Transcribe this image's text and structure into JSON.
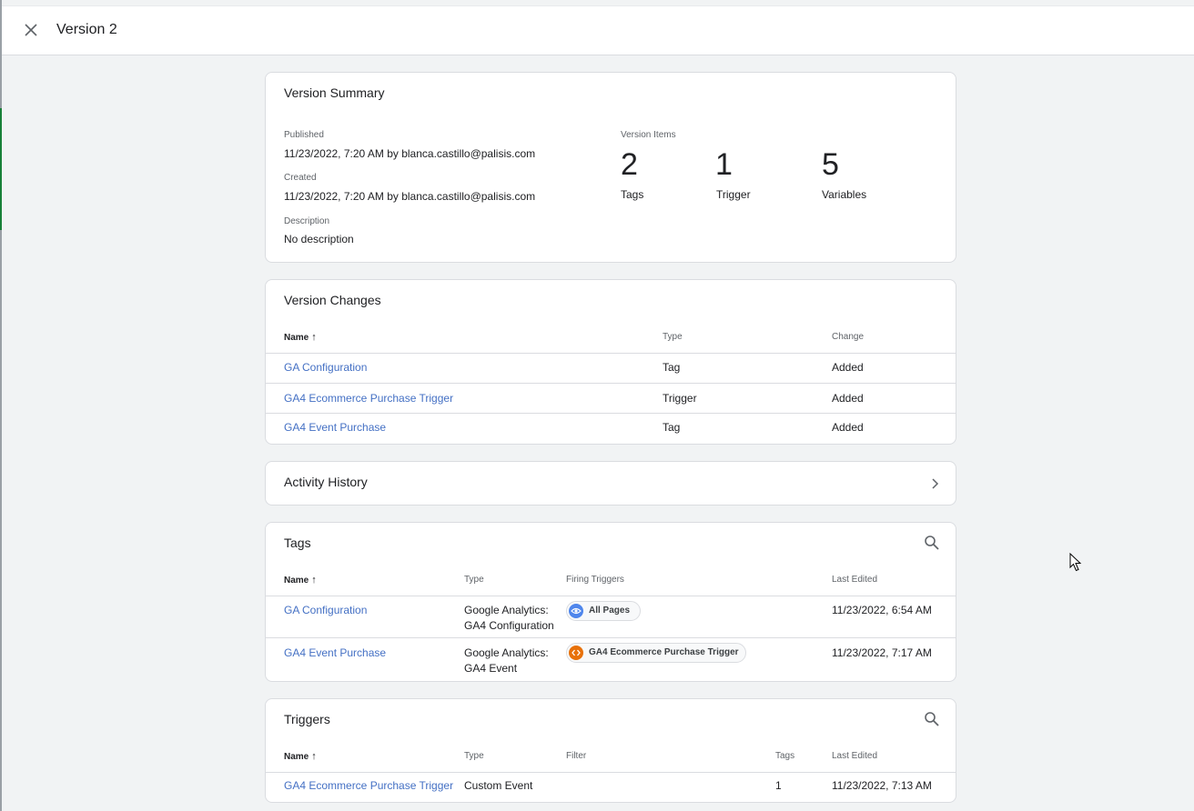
{
  "header": {
    "title": "Version 2"
  },
  "summary": {
    "title": "Version Summary",
    "published_label": "Published",
    "published_value": "11/23/2022, 7:20 AM by blanca.castillo@palisis.com",
    "created_label": "Created",
    "created_value": "11/23/2022, 7:20 AM by blanca.castillo@palisis.com",
    "description_label": "Description",
    "description_value": "No description",
    "items_label": "Version Items",
    "items": [
      {
        "count": "2",
        "label": "Tags"
      },
      {
        "count": "1",
        "label": "Trigger"
      },
      {
        "count": "5",
        "label": "Variables"
      }
    ]
  },
  "changes": {
    "title": "Version Changes",
    "columns": {
      "name": "Name",
      "type": "Type",
      "change": "Change"
    },
    "rows": [
      {
        "name": "GA Configuration",
        "type": "Tag",
        "change": "Added"
      },
      {
        "name": "GA4 Ecommerce Purchase Trigger",
        "type": "Trigger",
        "change": "Added"
      },
      {
        "name": "GA4 Event Purchase",
        "type": "Tag",
        "change": "Added"
      }
    ]
  },
  "activity": {
    "title": "Activity History"
  },
  "tags": {
    "title": "Tags",
    "columns": {
      "name": "Name",
      "type": "Type",
      "firing": "Firing Triggers",
      "edited": "Last Edited"
    },
    "rows": [
      {
        "name": "GA Configuration",
        "type": "Google Analytics: GA4 Configuration",
        "trigger": "All Pages",
        "trigger_icon": "eye-icon",
        "trigger_color": "#4f86ec",
        "edited": "11/23/2022, 6:54 AM"
      },
      {
        "name": "GA4 Event Purchase",
        "type": "Google Analytics: GA4 Event",
        "trigger": "GA4 Ecommerce Purchase Trigger",
        "trigger_icon": "code-icon",
        "trigger_color": "#e8710a",
        "edited": "11/23/2022, 7:17 AM"
      }
    ]
  },
  "triggers": {
    "title": "Triggers",
    "columns": {
      "name": "Name",
      "type": "Type",
      "filter": "Filter",
      "tags": "Tags",
      "edited": "Last Edited"
    },
    "rows": [
      {
        "name": "GA4 Ecommerce Purchase Trigger",
        "type": "Custom Event",
        "filter": "",
        "tags": "1",
        "edited": "11/23/2022, 7:13 AM"
      }
    ]
  },
  "colors": {
    "link": "#4470c4",
    "accent_green": "#188038"
  }
}
